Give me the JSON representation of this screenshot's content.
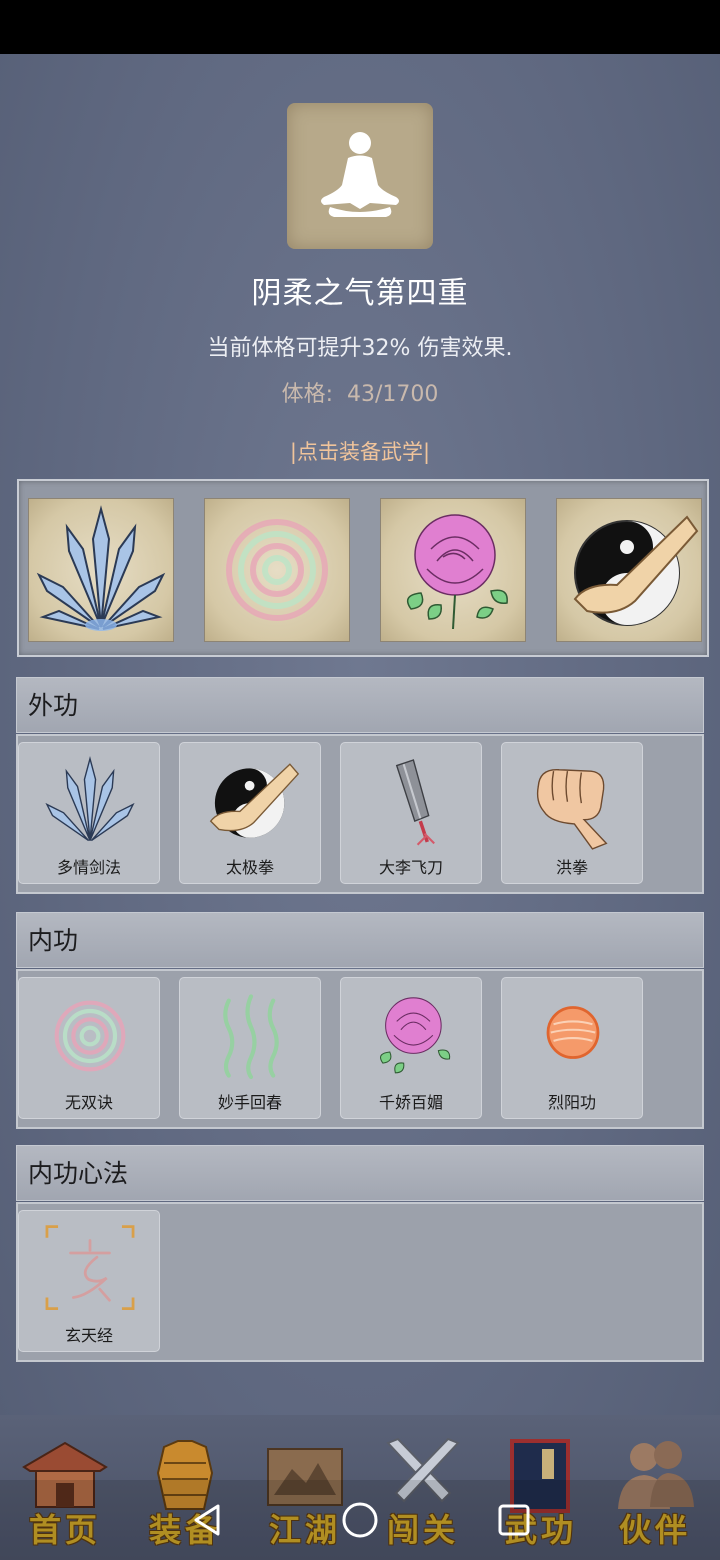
{
  "realm": {
    "title": "阴柔之气第四重",
    "description": "当前体格可提升32% 伤害效果.",
    "stat_label": "体格:",
    "stat_value": "43/1700",
    "equip_link": "|点击装备武学|"
  },
  "equipped_slots": [
    {
      "icon": "sword-fan-icon"
    },
    {
      "icon": "spiral-icon"
    },
    {
      "icon": "rose-icon"
    },
    {
      "icon": "taiji-fist-icon"
    }
  ],
  "sections": {
    "outer": {
      "title": "外功",
      "skills": [
        {
          "name": "多情剑法",
          "icon": "sword-fan-icon"
        },
        {
          "name": "太极拳",
          "icon": "taiji-fist-icon"
        },
        {
          "name": "大李飞刀",
          "icon": "flying-knife-icon"
        },
        {
          "name": "洪拳",
          "icon": "fist-icon"
        }
      ]
    },
    "inner": {
      "title": "内功",
      "skills": [
        {
          "name": "无双诀",
          "icon": "spiral-icon"
        },
        {
          "name": "妙手回春",
          "icon": "healing-waves-icon"
        },
        {
          "name": "千娇百媚",
          "icon": "rose-icon"
        },
        {
          "name": "烈阳功",
          "icon": "sun-orb-icon"
        }
      ]
    },
    "mind": {
      "title": "内功心法",
      "skills": [
        {
          "name": "玄天经",
          "icon": "xuan-seal-icon"
        }
      ]
    }
  },
  "nav": {
    "items": [
      {
        "label": "首页",
        "icon": "house-icon"
      },
      {
        "label": "装备",
        "icon": "armor-icon"
      },
      {
        "label": "江湖",
        "icon": "scroll-map-icon"
      },
      {
        "label": "闯关",
        "icon": "crossed-swords-icon"
      },
      {
        "label": "武功",
        "icon": "book-icon"
      },
      {
        "label": "伙伴",
        "icon": "companions-icon"
      }
    ],
    "active_index": 4
  },
  "colors": {
    "background": "#616b82",
    "title_text": "#ffffff",
    "stat_text": "#c9b9ad",
    "link_text": "#f0c49b",
    "nav_label": "#c9a227"
  }
}
